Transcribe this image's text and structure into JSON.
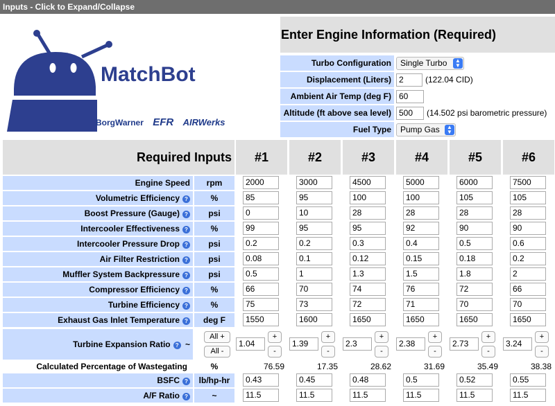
{
  "titlebar": "Inputs - Click to Expand/Collapse",
  "logo": {
    "name": "MatchBot",
    "brands": [
      "BorgWarner",
      "EFR",
      "AIRWerks"
    ]
  },
  "engine": {
    "title": "Enter Engine Information (Required)",
    "turbo_label": "Turbo Configuration",
    "turbo_value": "Single Turbo",
    "displacement_label": "Displacement (Liters)",
    "displacement_value": "2",
    "displacement_note": "(122.04 CID)",
    "ambient_label": "Ambient Air Temp (deg F)",
    "ambient_value": "60",
    "altitude_label": "Altitude (ft above sea level)",
    "altitude_value": "500",
    "altitude_note": "(14.502 psi barometric pressure)",
    "fuel_label": "Fuel Type",
    "fuel_value": "Pump Gas"
  },
  "table": {
    "header": "Required Inputs",
    "columns": [
      "#1",
      "#2",
      "#3",
      "#4",
      "#5",
      "#6"
    ],
    "rows": [
      {
        "label": "Engine Speed",
        "info": false,
        "unit": "rpm",
        "values": [
          "2000",
          "3000",
          "4500",
          "5000",
          "6000",
          "7500"
        ]
      },
      {
        "label": "Volumetric Efficiency",
        "info": true,
        "unit": "%",
        "values": [
          "85",
          "95",
          "100",
          "100",
          "105",
          "105"
        ]
      },
      {
        "label": "Boost Pressure (Gauge)",
        "info": true,
        "unit": "psi",
        "values": [
          "0",
          "10",
          "28",
          "28",
          "28",
          "28"
        ]
      },
      {
        "label": "Intercooler Effectiveness",
        "info": true,
        "unit": "%",
        "values": [
          "99",
          "95",
          "95",
          "92",
          "90",
          "90"
        ]
      },
      {
        "label": "Intercooler Pressure Drop",
        "info": true,
        "unit": "psi",
        "values": [
          "0.2",
          "0.2",
          "0.3",
          "0.4",
          "0.5",
          "0.6"
        ]
      },
      {
        "label": "Air Filter Restriction",
        "info": true,
        "unit": "psi",
        "values": [
          "0.08",
          "0.1",
          "0.12",
          "0.15",
          "0.18",
          "0.2"
        ]
      },
      {
        "label": "Muffler System Backpressure",
        "info": true,
        "unit": "psi",
        "values": [
          "0.5",
          "1",
          "1.3",
          "1.5",
          "1.8",
          "2"
        ]
      },
      {
        "label": "Compressor Efficiency",
        "info": true,
        "unit": "%",
        "values": [
          "66",
          "70",
          "74",
          "76",
          "72",
          "66"
        ]
      },
      {
        "label": "Turbine Efficiency",
        "info": true,
        "unit": "%",
        "values": [
          "75",
          "73",
          "72",
          "71",
          "70",
          "70"
        ]
      },
      {
        "label": "Exhaust Gas Inlet Temperature",
        "info": true,
        "unit": "deg F",
        "values": [
          "1550",
          "1600",
          "1650",
          "1650",
          "1650",
          "1650"
        ]
      }
    ],
    "expansion": {
      "label": "Turbine Expansion Ratio",
      "unit": "~",
      "all_plus": "All +",
      "all_minus": "All -",
      "plus": "+",
      "minus": "-",
      "values": [
        "1.04",
        "1.39",
        "2.3",
        "2.38",
        "2.73",
        "3.24"
      ]
    },
    "wastegate": {
      "label": "Calculated Percentage of Wastegating",
      "unit": "%",
      "values": [
        "76.59",
        "17.35",
        "28.62",
        "31.69",
        "35.49",
        "38.38"
      ]
    },
    "bsfc": {
      "label": "BSFC",
      "unit": "lb/hp-hr",
      "values": [
        "0.43",
        "0.45",
        "0.48",
        "0.5",
        "0.52",
        "0.55"
      ]
    },
    "afr": {
      "label": "A/F Ratio",
      "unit": "~",
      "values": [
        "11.5",
        "11.5",
        "11.5",
        "11.5",
        "11.5",
        "11.5"
      ]
    }
  },
  "colors": {
    "label_bg": "#c9dcff",
    "header_bg": "#e0e0e0",
    "titlebar_bg": "#6e6e6e",
    "logo_blue": "#2d3f8f",
    "info_blue": "#3a6fd8"
  }
}
